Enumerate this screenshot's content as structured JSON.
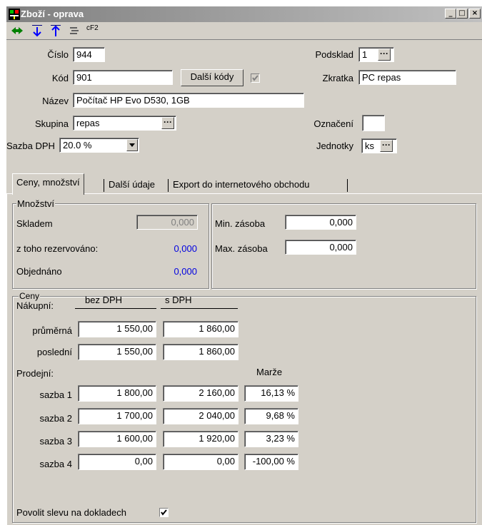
{
  "window": {
    "title": "Zboží - oprava"
  },
  "titlebar_buttons": {
    "minimize": "_",
    "maximize": "□",
    "close": "×"
  },
  "toolbar": {
    "f2_label": "cF2"
  },
  "header": {
    "cislo_label": "Číslo",
    "cislo_value": "944",
    "podsklad_label": "Podsklad",
    "podsklad_value": "1",
    "kod_label": "Kód",
    "kod_value": "901",
    "dalsi_kody_label": "Další kódy",
    "zkratka_label": "Zkratka",
    "zkratka_value": "PC repas",
    "nazev_label": "Název",
    "nazev_value": "Počítač HP Evo D530, 1GB",
    "skupina_label": "Skupina",
    "skupina_value": "repas",
    "oznaceni_label": "Označení",
    "oznaceni_value": "",
    "sazba_label": "Sazba DPH",
    "sazba_value": "20.0 %",
    "jednotky_label": "Jednotky",
    "jednotky_value": "ks",
    "dots": "···"
  },
  "tabs": [
    {
      "label": "Ceny, množství"
    },
    {
      "label": "Další údaje"
    },
    {
      "label": "Export do internetového obchodu"
    }
  ],
  "mnozstvi": {
    "title": "Množství",
    "skladem_label": "Skladem",
    "skladem_value": "0,000",
    "rezervovano_label": "z toho rezervováno:",
    "rezervovano_value": "0,000",
    "objednano_label": "Objednáno",
    "objednano_value": "0,000",
    "min_label": "Min. zásoba",
    "min_value": "0,000",
    "max_label": "Max. zásoba",
    "max_value": "0,000"
  },
  "ceny": {
    "title": "Ceny",
    "nakupni_label": "Nákupní:",
    "bez_dph_label": "bez DPH",
    "s_dph_label": "s DPH",
    "prodejni_label": "Prodejní:",
    "marze_label": "Marže",
    "nakupni_rows": [
      {
        "label": "průměrná",
        "bez": "1 550,00",
        "s": "1 860,00"
      },
      {
        "label": "poslední",
        "bez": "1 550,00",
        "s": "1 860,00"
      }
    ],
    "prodejni_rows": [
      {
        "label": "sazba 1",
        "bez": "1 800,00",
        "s": "2 160,00",
        "marze": "16,13 %"
      },
      {
        "label": "sazba 2",
        "bez": "1 700,00",
        "s": "2 040,00",
        "marze": "9,68 %"
      },
      {
        "label": "sazba 3",
        "bez": "1 600,00",
        "s": "1 920,00",
        "marze": "3,23 %"
      },
      {
        "label": "sazba 4",
        "bez": "0,00",
        "s": "0,00",
        "marze": "-100,00 %"
      }
    ],
    "povolit_label": "Povolit slevu na dokladech"
  },
  "colors": {
    "face": "#d4d0c8",
    "value_blue": "#0000e0"
  }
}
